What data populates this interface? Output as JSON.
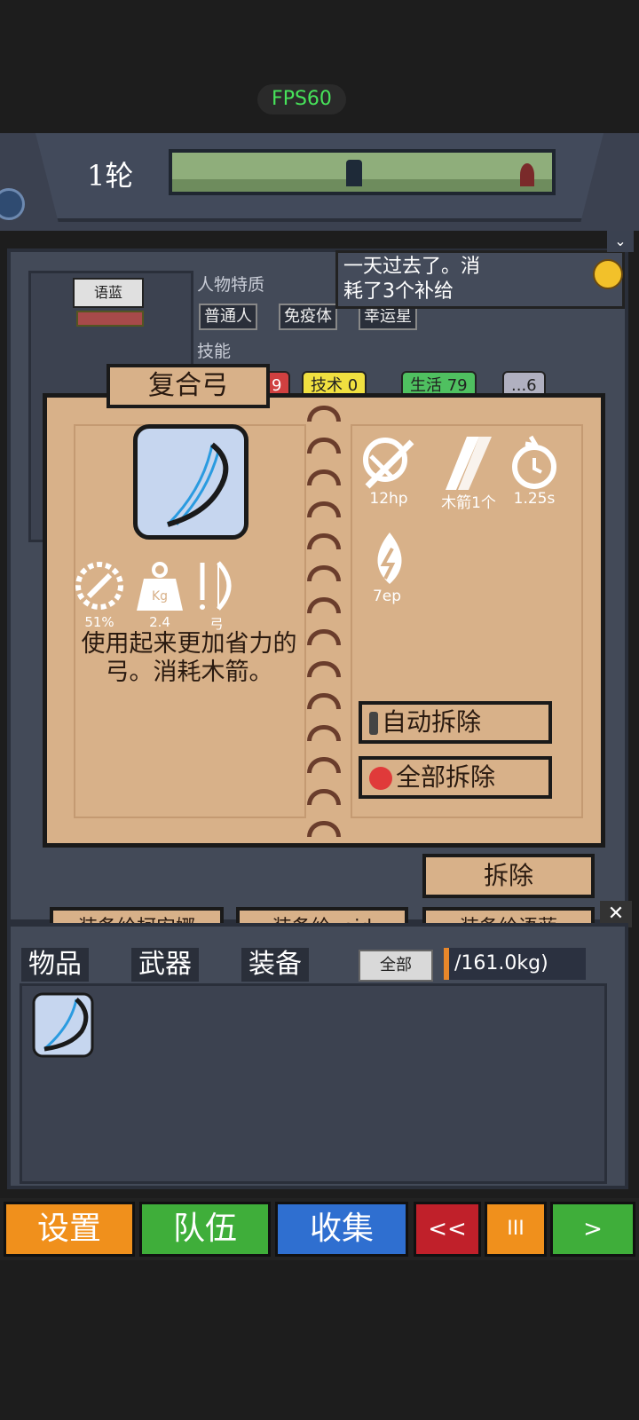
{
  "hud": {
    "fps": "FPS60",
    "round": "1轮"
  },
  "character": {
    "name": "语蓝",
    "traits_label": "人物特质",
    "traits": [
      "普通人",
      "免疫体",
      "幸运星"
    ],
    "skills_label": "技能",
    "skills": [
      {
        "label": "9",
        "color": "#d04040"
      },
      {
        "label": "技术 0",
        "color": "#f0e040"
      },
      {
        "label": "生活 79",
        "color": "#4fc060"
      },
      {
        "label": "...6",
        "color": "#b0b0c0"
      }
    ]
  },
  "toast": {
    "text_line1": "一天过去了。消",
    "text_line2": "耗了3个补给"
  },
  "item": {
    "title": "复合弓",
    "description": "使用起来更加省力的弓。消耗木箭。",
    "stats_left": [
      {
        "icon": "durability-icon",
        "label": "51%"
      },
      {
        "icon": "weight-icon",
        "label": "2.4"
      },
      {
        "icon": "bow-type-icon",
        "label": "弓"
      }
    ],
    "stats_right": [
      {
        "icon": "damage-icon",
        "label": "12hp"
      },
      {
        "icon": "arrow-ammo-icon",
        "label": "木箭1个"
      },
      {
        "icon": "cooldown-icon",
        "label": "1.25s"
      },
      {
        "icon": "energy-drop-icon",
        "label": "7ep"
      }
    ],
    "auto_dismantle": "自动拆除",
    "dismantle_all": "全部拆除",
    "dismantle": "拆除"
  },
  "equip": {
    "to_kiana": "装备给柯安娜",
    "to_void": "装备给void",
    "to_yulan": "装备给语蓝"
  },
  "inventory": {
    "tabs": [
      "物品",
      "武器",
      "装备"
    ],
    "filter": "全部",
    "weight": "/161.0kg)"
  },
  "bottom": {
    "settings": "设置",
    "team": "队伍",
    "collect": "收集",
    "rewind": "<<",
    "pause": "III",
    "play": ">"
  },
  "colors": {
    "settings": "#f0901c",
    "team": "#3fae3a",
    "collect": "#2f6fd0",
    "rewind": "#c0202a",
    "pause": "#f0901c",
    "play": "#3fae3a"
  }
}
